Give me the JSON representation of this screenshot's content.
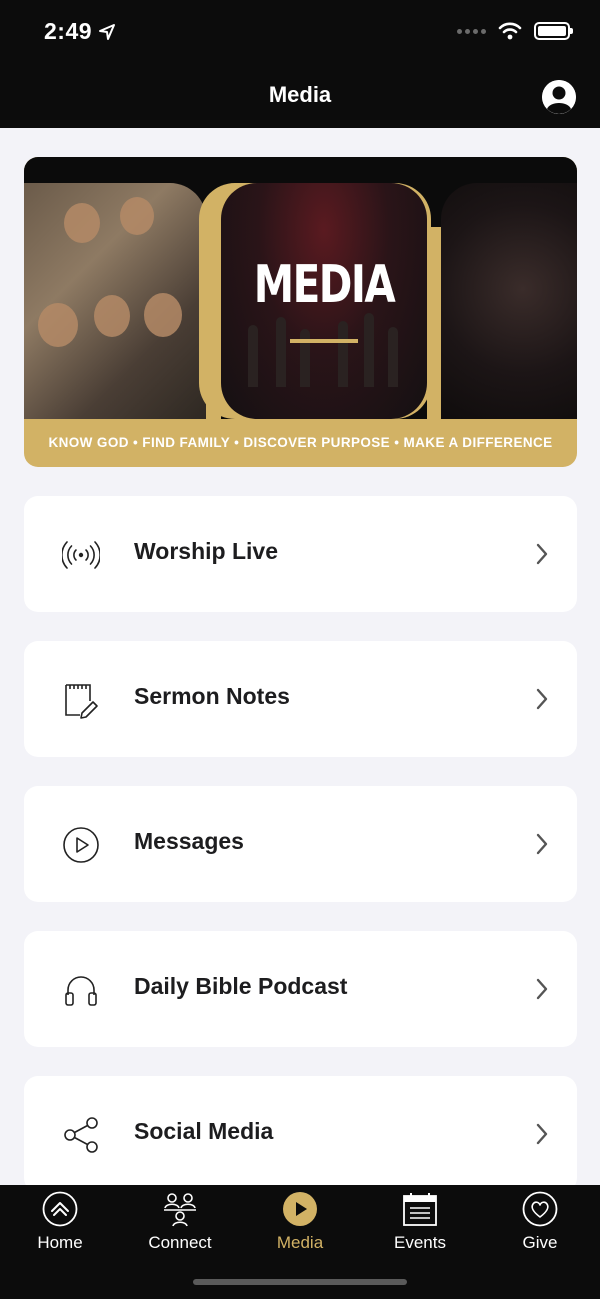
{
  "status_bar": {
    "time": "2:49"
  },
  "header": {
    "title": "Media"
  },
  "banner": {
    "title": "MEDIA",
    "tagline": "KNOW GOD • FIND FAMILY • DISCOVER PURPOSE • MAKE A DIFFERENCE"
  },
  "menu": {
    "items": [
      {
        "label": "Worship Live",
        "icon": "broadcast-icon"
      },
      {
        "label": "Sermon Notes",
        "icon": "notes-icon"
      },
      {
        "label": "Messages",
        "icon": "play-circle-icon"
      },
      {
        "label": "Daily Bible Podcast",
        "icon": "headphones-icon"
      },
      {
        "label": "Social Media",
        "icon": "share-icon"
      }
    ]
  },
  "tabbar": {
    "tabs": [
      {
        "label": "Home",
        "icon": "home-chevron-icon",
        "active": false
      },
      {
        "label": "Connect",
        "icon": "group-icon",
        "active": false
      },
      {
        "label": "Media",
        "icon": "play-icon",
        "active": true
      },
      {
        "label": "Events",
        "icon": "calendar-icon",
        "active": false
      },
      {
        "label": "Give",
        "icon": "heart-icon",
        "active": false
      }
    ]
  },
  "colors": {
    "accent": "#d2b265",
    "header_bg": "#0c0c0c",
    "page_bg": "#f3f3f8"
  }
}
